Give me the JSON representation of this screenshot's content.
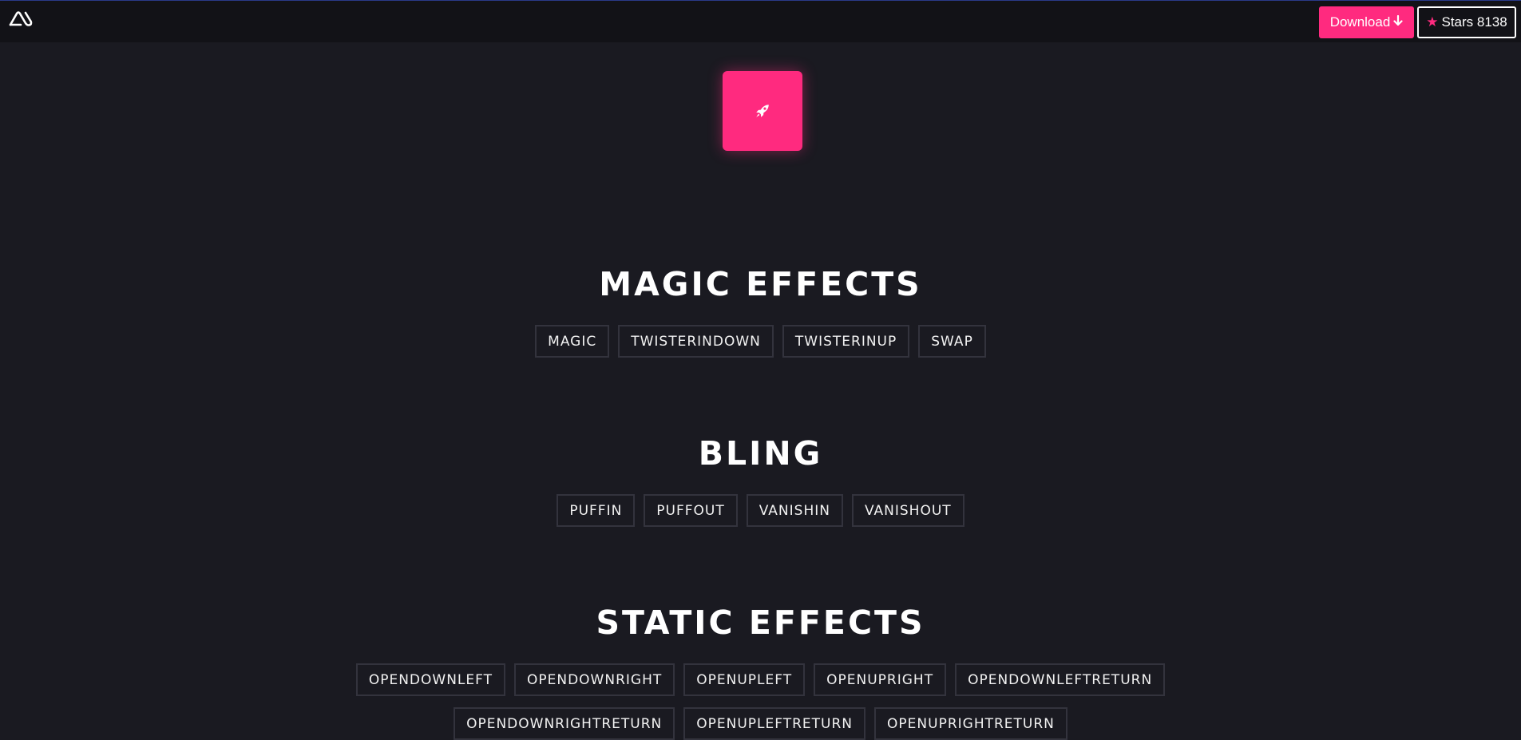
{
  "header": {
    "logo_icon": "logo-icon",
    "download_label": "Download",
    "download_icon": "arrow-down-icon",
    "stars_label": "Stars 8138",
    "stars_icon": "star-icon",
    "accent_color": "#ff2a7f"
  },
  "demo": {
    "icon": "rocket-icon"
  },
  "sections": {
    "magic": {
      "title": "MAGIC EFFECTS",
      "buttons": [
        "MAGIC",
        "TWISTERINDOWN",
        "TWISTERINUP",
        "SWAP"
      ]
    },
    "bling": {
      "title": "BLING",
      "buttons": [
        "PUFFIN",
        "PUFFOUT",
        "VANISHIN",
        "VANISHOUT"
      ]
    },
    "static": {
      "title": "STATIC EFFECTS",
      "buttons_row1": [
        "OPENDOWNLEFT",
        "OPENDOWNRIGHT",
        "OPENUPLEFT",
        "OPENUPRIGHT",
        "OPENDOWNLEFTRETURN"
      ],
      "buttons_row2": [
        "OPENDOWNRIGHTRETURN",
        "OPENUPLEFTRETURN",
        "OPENUPRIGHTRETURN"
      ]
    }
  }
}
